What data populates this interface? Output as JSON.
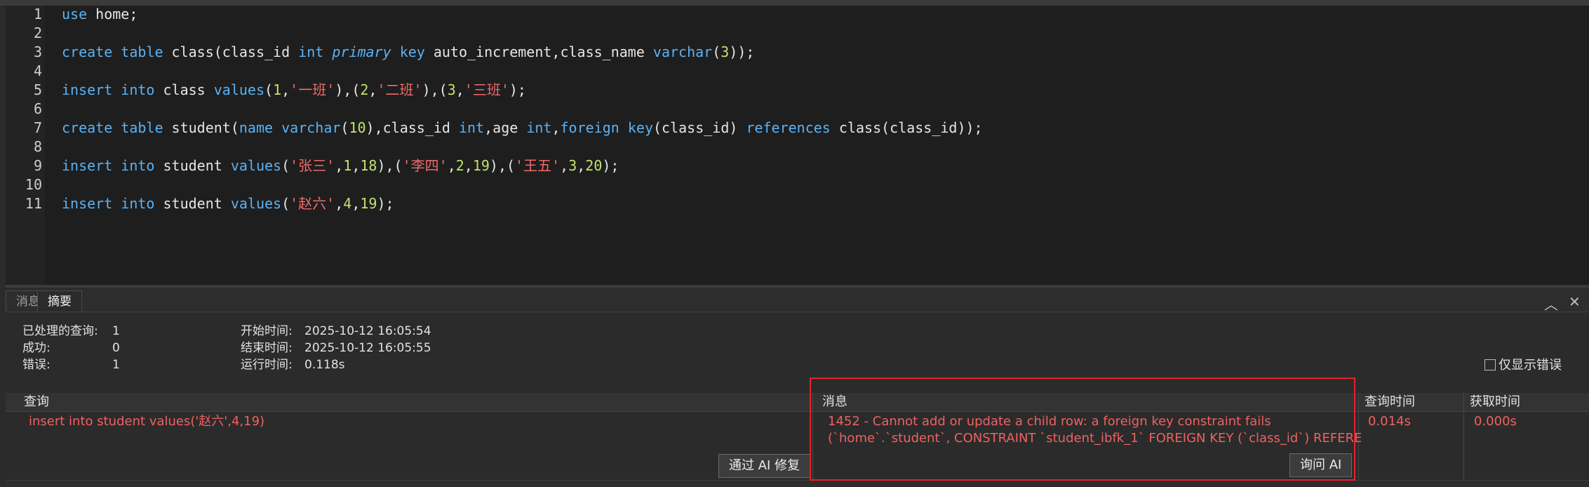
{
  "editor": {
    "line_numbers": [
      "1",
      "2",
      "3",
      "4",
      "5",
      "6",
      "7",
      "8",
      "9",
      "10",
      "11"
    ],
    "lines": [
      [
        {
          "t": "use",
          "c": "kw"
        },
        {
          "t": " home;"
        }
      ],
      [],
      [
        {
          "t": "create",
          "c": "kw"
        },
        {
          "t": " "
        },
        {
          "t": "table",
          "c": "kw"
        },
        {
          "t": " class(class_id "
        },
        {
          "t": "int",
          "c": "kw"
        },
        {
          "t": " "
        },
        {
          "t": "primary",
          "c": "kwi"
        },
        {
          "t": " "
        },
        {
          "t": "key",
          "c": "kw"
        },
        {
          "t": " auto_increment,class_name "
        },
        {
          "t": "varchar",
          "c": "kw"
        },
        {
          "t": "("
        },
        {
          "t": "3",
          "c": "num"
        },
        {
          "t": "));"
        }
      ],
      [],
      [
        {
          "t": "insert",
          "c": "kw"
        },
        {
          "t": " "
        },
        {
          "t": "into",
          "c": "kw"
        },
        {
          "t": " class "
        },
        {
          "t": "values",
          "c": "kw"
        },
        {
          "t": "("
        },
        {
          "t": "1",
          "c": "num"
        },
        {
          "t": ","
        },
        {
          "t": "'一班'",
          "c": "str"
        },
        {
          "t": "),("
        },
        {
          "t": "2",
          "c": "num"
        },
        {
          "t": ","
        },
        {
          "t": "'二班'",
          "c": "str"
        },
        {
          "t": "),("
        },
        {
          "t": "3",
          "c": "num"
        },
        {
          "t": ","
        },
        {
          "t": "'三班'",
          "c": "str"
        },
        {
          "t": ");"
        }
      ],
      [],
      [
        {
          "t": "create",
          "c": "kw"
        },
        {
          "t": " "
        },
        {
          "t": "table",
          "c": "kw"
        },
        {
          "t": " student("
        },
        {
          "t": "name",
          "c": "kw"
        },
        {
          "t": " "
        },
        {
          "t": "varchar",
          "c": "kw"
        },
        {
          "t": "("
        },
        {
          "t": "10",
          "c": "num"
        },
        {
          "t": "),class_id "
        },
        {
          "t": "int",
          "c": "kw"
        },
        {
          "t": ",age "
        },
        {
          "t": "int",
          "c": "kw"
        },
        {
          "t": ","
        },
        {
          "t": "foreign",
          "c": "kw"
        },
        {
          "t": " "
        },
        {
          "t": "key",
          "c": "kw"
        },
        {
          "t": "(class_id) "
        },
        {
          "t": "references",
          "c": "kw"
        },
        {
          "t": " class(class_id));"
        }
      ],
      [],
      [
        {
          "t": "insert",
          "c": "kw"
        },
        {
          "t": " "
        },
        {
          "t": "into",
          "c": "kw"
        },
        {
          "t": " student "
        },
        {
          "t": "values",
          "c": "kw"
        },
        {
          "t": "("
        },
        {
          "t": "'张三'",
          "c": "str"
        },
        {
          "t": ","
        },
        {
          "t": "1",
          "c": "num"
        },
        {
          "t": ","
        },
        {
          "t": "18",
          "c": "num"
        },
        {
          "t": "),("
        },
        {
          "t": "'李四'",
          "c": "str"
        },
        {
          "t": ","
        },
        {
          "t": "2",
          "c": "num"
        },
        {
          "t": ","
        },
        {
          "t": "19",
          "c": "num"
        },
        {
          "t": "),("
        },
        {
          "t": "'王五'",
          "c": "str"
        },
        {
          "t": ","
        },
        {
          "t": "3",
          "c": "num"
        },
        {
          "t": ","
        },
        {
          "t": "20",
          "c": "num"
        },
        {
          "t": ");"
        }
      ],
      [],
      [
        {
          "t": "insert",
          "c": "kw"
        },
        {
          "t": " "
        },
        {
          "t": "into",
          "c": "kw"
        },
        {
          "t": " student "
        },
        {
          "t": "values",
          "c": "kw"
        },
        {
          "t": "("
        },
        {
          "t": "'赵六'",
          "c": "str"
        },
        {
          "t": ","
        },
        {
          "t": "4",
          "c": "num"
        },
        {
          "t": ","
        },
        {
          "t": "19",
          "c": "num"
        },
        {
          "t": ");"
        }
      ]
    ]
  },
  "tabs": [
    {
      "label": "消息",
      "active": false
    },
    {
      "label": "摘要",
      "active": true
    }
  ],
  "panel_controls": {
    "collapse_icon": "chevron-up-icon",
    "collapse_glyph": "︿",
    "close_icon": "close-icon",
    "close_glyph": "✕"
  },
  "summary": {
    "processed_label": "已处理的查询:",
    "processed_value": "1",
    "success_label": "成功:",
    "success_value": "0",
    "error_label": "错误:",
    "error_value": "1",
    "start_label": "开始时间:",
    "start_value": "2025-10-12 16:05:54",
    "end_label": "结束时间:",
    "end_value": "2025-10-12 16:05:55",
    "run_label": "运行时间:",
    "run_value": "0.118s"
  },
  "only_errors": {
    "label": "仅显示错误",
    "checked": false
  },
  "results": {
    "headers": {
      "query": "查询",
      "message": "消息",
      "query_time": "查询时间",
      "fetch_time": "获取时间"
    },
    "rows": [
      {
        "query": "insert into student values('赵六',4,19)",
        "message_line1": "1452 - Cannot add or update a child row: a foreign key constraint fails",
        "message_line2": "(`home`.`student`, CONSTRAINT `student_ibfk_1` FOREIGN KEY (`class_id`) REFERENCES",
        "query_time": "0.014s",
        "fetch_time": "0.000s"
      }
    ],
    "fix_button": "通过 AI 修复",
    "ask_button": "询问 AI"
  },
  "colors": {
    "error_text": "#f06060",
    "highlight_border": "#e8202c",
    "keyword": "#5ab2f5",
    "number": "#c2e36e",
    "string": "#f06a6a"
  }
}
